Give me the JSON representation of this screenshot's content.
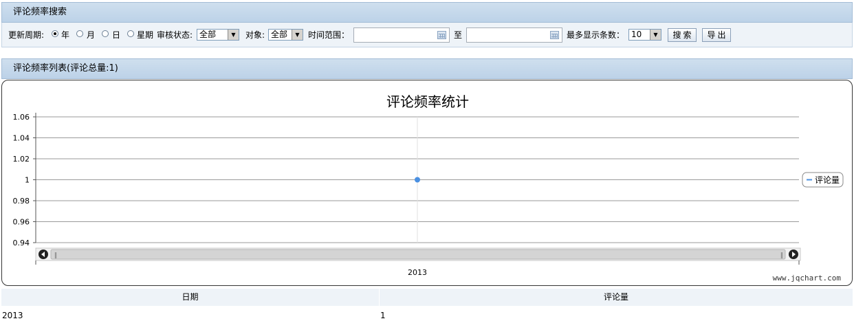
{
  "search_panel": {
    "title": "评论频率搜索",
    "period_label": "更新周期:",
    "period_options": [
      "年",
      "月",
      "日",
      "星期"
    ],
    "period_selected": "年",
    "status_label": "审核状态:",
    "status_value": "全部",
    "target_label": "对象:",
    "target_value": "全部",
    "range_label": "时间范围：",
    "range_from": "",
    "range_to_label": "至",
    "range_to": "",
    "max_rows_label": "最多显示条数：",
    "max_rows_value": "10",
    "search_button": "搜索",
    "export_button": "导出"
  },
  "list_panel": {
    "title": "评论频率列表(评论总量:1)"
  },
  "chart_data": {
    "type": "line",
    "title": "评论频率统计",
    "categories": [
      "2013"
    ],
    "series": [
      {
        "name": "评论量",
        "values": [
          1
        ],
        "color": "#4a90e2"
      }
    ],
    "ylim": [
      0.94,
      1.06
    ],
    "yticks": [
      "1.06",
      "1.04",
      "1.02",
      "1",
      "0.98",
      "0.96",
      "0.94"
    ],
    "legend": "right",
    "grid": true,
    "scrollbar": true,
    "watermark": "www.jqchart.com"
  },
  "table": {
    "columns": [
      "日期",
      "评论量"
    ],
    "rows": [
      [
        "2013",
        "1"
      ]
    ]
  }
}
